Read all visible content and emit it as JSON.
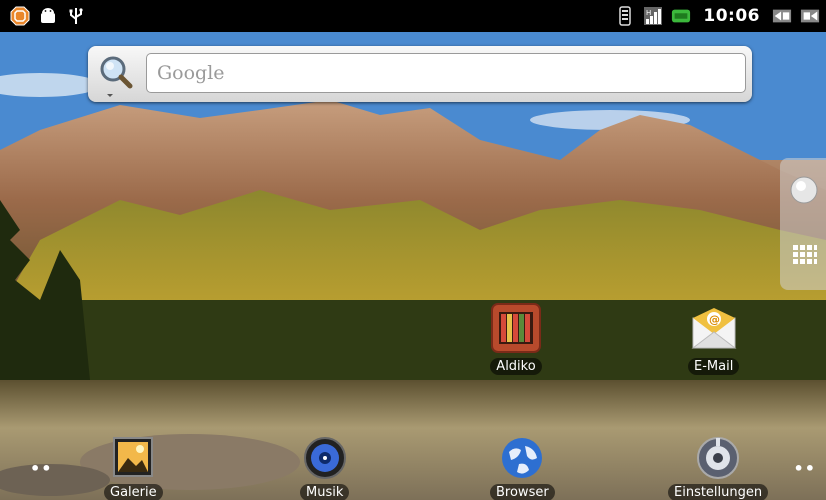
{
  "statusbar": {
    "left_icons": [
      "warning-icon",
      "android-icon",
      "usb-icon"
    ],
    "right_icons": [
      "vibrate-icon",
      "signal-icon",
      "battery-icon"
    ],
    "time": "10:06",
    "end_icons": [
      "screen-icon",
      "volume-icon"
    ]
  },
  "search": {
    "placeholder": "Google"
  },
  "desktop_icons": {
    "aldiko": "Aldiko",
    "email": "E-Mail"
  },
  "dock": {
    "galerie": "Galerie",
    "musik": "Musik",
    "browser": "Browser",
    "einstellungen": "Einstellungen"
  }
}
